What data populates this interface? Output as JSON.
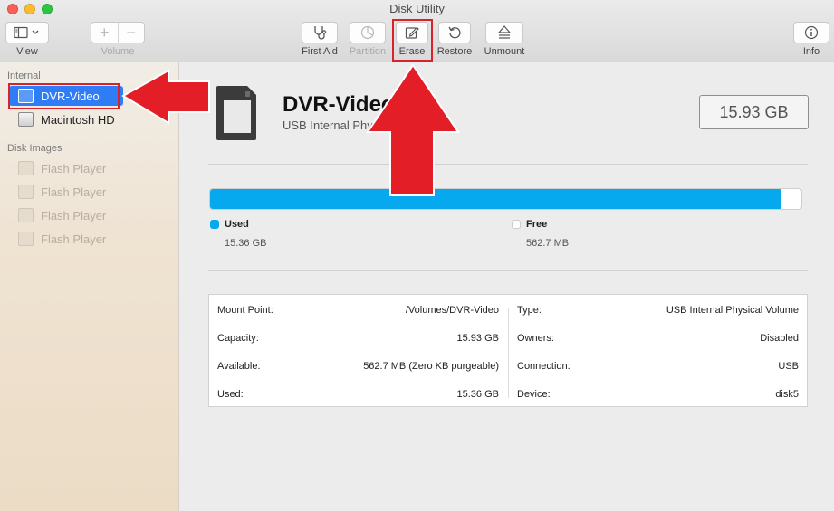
{
  "window": {
    "title": "Disk Utility"
  },
  "toolbar": {
    "view_label": "View",
    "volume_label": "Volume",
    "volume_add": "+",
    "volume_remove": "−",
    "first_aid_label": "First Aid",
    "partition_label": "Partition",
    "erase_label": "Erase",
    "restore_label": "Restore",
    "unmount_label": "Unmount",
    "info_label": "Info"
  },
  "sidebar": {
    "internal_header": "Internal",
    "internal_items": [
      {
        "label": "DVR-Video",
        "selected": true
      },
      {
        "label": "Macintosh HD",
        "selected": false
      }
    ],
    "disk_images_header": "Disk Images",
    "disk_image_items": [
      {
        "label": "Flash Player"
      },
      {
        "label": "Flash Player"
      },
      {
        "label": "Flash Player"
      },
      {
        "label": "Flash Player"
      }
    ]
  },
  "disk": {
    "name": "DVR-Video",
    "subtitle": "USB Internal Phy",
    "size": "15.93 GB",
    "used_fraction": 0.965
  },
  "usage": {
    "used_label": "Used",
    "used_value": "15.36 GB",
    "free_label": "Free",
    "free_value": "562.7 MB",
    "used_color": "#07a9ee",
    "free_color": "#ffffff"
  },
  "info": {
    "left": [
      {
        "key": "Mount Point:",
        "value": "/Volumes/DVR-Video"
      },
      {
        "key": "Capacity:",
        "value": "15.93 GB"
      },
      {
        "key": "Available:",
        "value": "562.7 MB (Zero KB purgeable)"
      },
      {
        "key": "Used:",
        "value": "15.36 GB"
      }
    ],
    "right": [
      {
        "key": "Type:",
        "value": "USB Internal Physical Volume"
      },
      {
        "key": "Owners:",
        "value": "Disabled"
      },
      {
        "key": "Connection:",
        "value": "USB"
      },
      {
        "key": "Device:",
        "value": "disk5"
      }
    ]
  },
  "annotation_color": "#e41e26"
}
